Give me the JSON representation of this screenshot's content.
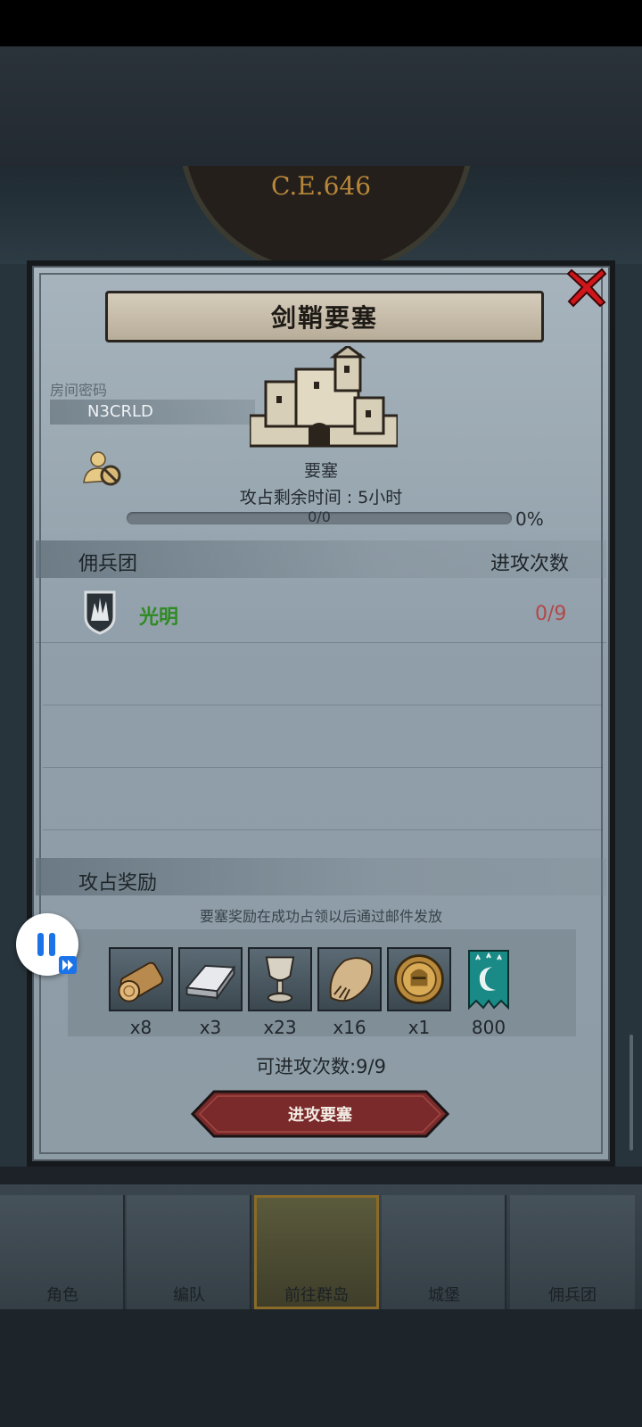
{
  "header": {
    "era_date": "C.E.646"
  },
  "dialog": {
    "title": "剑鞘要塞",
    "room_password_label": "房间密码",
    "room_password": "N3CRLD",
    "fortress_type": "要塞",
    "capture_time_label": "攻占剩余时间",
    "capture_time_sep": ":",
    "capture_time_value": "5小时",
    "progress_text": "0/0",
    "progress_percent": "0%",
    "progress_fraction": 0
  },
  "mercenary": {
    "column_guild": "佣兵团",
    "column_attacks": "进攻次数",
    "rows": [
      {
        "name": "光明",
        "attacks": "0/9",
        "emblem": "shield-emblem-icon"
      }
    ]
  },
  "rewards": {
    "title": "攻占奖励",
    "note": "要塞奖励在成功占领以后通过邮件发放",
    "items": [
      {
        "icon": "wood-log-icon",
        "qty": "x8"
      },
      {
        "icon": "iron-ingot-icon",
        "qty": "x3"
      },
      {
        "icon": "goblet-icon",
        "qty": "x23"
      },
      {
        "icon": "fur-pelt-icon",
        "qty": "x16"
      },
      {
        "icon": "knight-medal-icon",
        "qty": "x1"
      },
      {
        "icon": "guild-banner-icon",
        "qty": "800"
      }
    ]
  },
  "available_attacks": {
    "label": "可进攻次数",
    "sep": ":",
    "value": "9/9"
  },
  "attack_button": "进攻要塞",
  "nav": {
    "items": [
      {
        "label": "角色"
      },
      {
        "label": "编队"
      },
      {
        "label": "前往群岛"
      },
      {
        "label": "城堡"
      },
      {
        "label": "佣兵团"
      }
    ]
  },
  "colors": {
    "guild_name": "#2f8a22",
    "attacks_red": "#b34848",
    "button_red": "#7a2a2a"
  }
}
